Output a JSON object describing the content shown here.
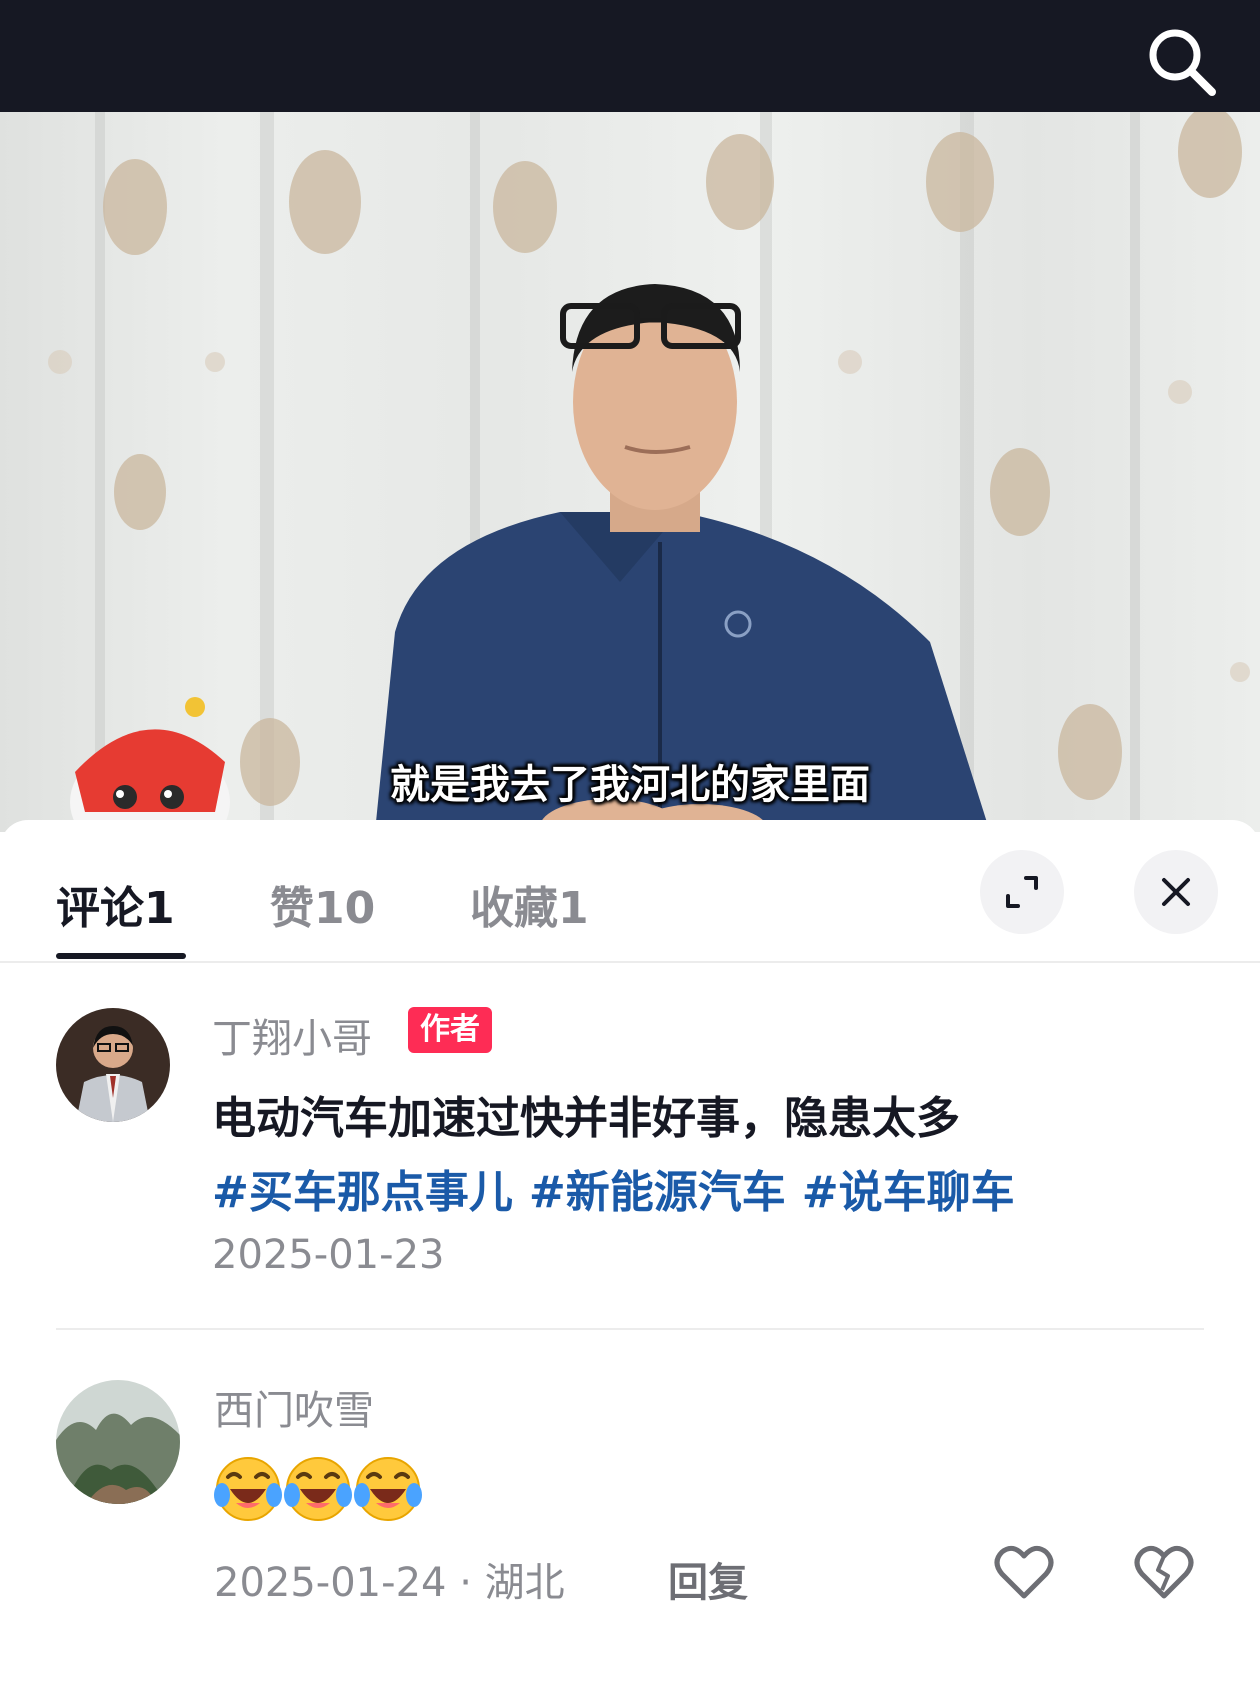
{
  "video": {
    "subtitle": "就是我去了我河北的家里面"
  },
  "tabs": [
    {
      "label": "评论",
      "count": "1",
      "active": true
    },
    {
      "label": "赞",
      "count": "10",
      "active": false
    },
    {
      "label": "收藏",
      "count": "1",
      "active": false
    }
  ],
  "comments": [
    {
      "username": "丁翔小哥",
      "badge": "作者",
      "text": "电动汽车加速过快并非好事，隐患太多",
      "hashtags": [
        "#买车那点事儿",
        "#新能源汽车",
        "#说车聊车"
      ],
      "date": "2025-01-23"
    },
    {
      "username": "西门吹雪",
      "emojis": [
        "laughing-crying-emoji",
        "laughing-crying-emoji",
        "laughing-crying-emoji"
      ],
      "date": "2025-01-24",
      "separator": "·",
      "location": "湖北",
      "reply_label": "回复"
    }
  ],
  "colors": {
    "top_bar": "#161823",
    "author_badge": "#fe2c55",
    "hashtag": "#1a5aa8",
    "muted_text": "#8a8b91"
  },
  "icons": [
    "search-icon",
    "expand-icon",
    "close-icon",
    "heart-icon",
    "broken-heart-icon"
  ]
}
